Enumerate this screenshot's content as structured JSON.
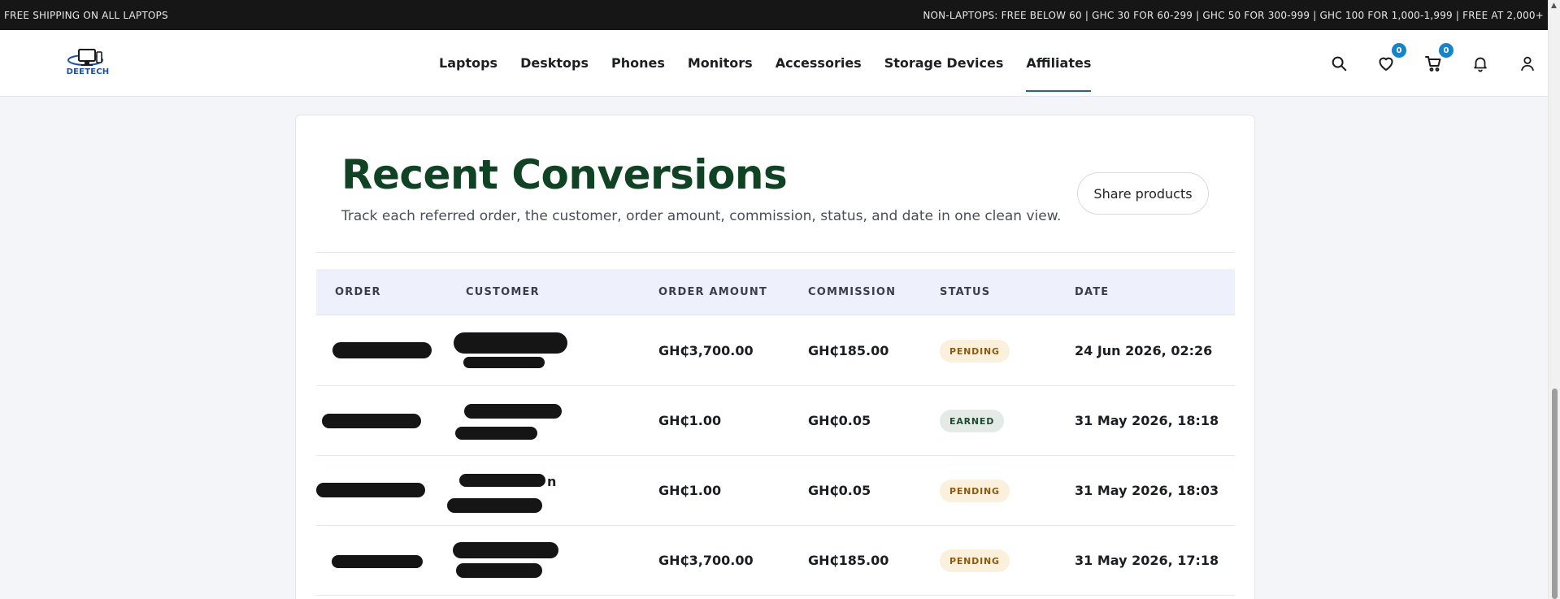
{
  "announcement": {
    "left": "FREE SHIPPING ON ALL LAPTOPS",
    "right": "NON-LAPTOPS: FREE BELOW 60 | GHC 30 FOR 60-299 | GHC 50 FOR 300-999 | GHC 100 FOR 1,000-1,999 | FREE AT 2,000+"
  },
  "brand": {
    "name": "DEETECH",
    "color": "#1d4fa3"
  },
  "nav": {
    "items": [
      {
        "label": "Laptops"
      },
      {
        "label": "Desktops"
      },
      {
        "label": "Phones"
      },
      {
        "label": "Monitors"
      },
      {
        "label": "Accessories"
      },
      {
        "label": "Storage Devices"
      },
      {
        "label": "Affiliates",
        "active": true
      }
    ]
  },
  "header_icons": {
    "wishlist_count": "0",
    "cart_count": "0",
    "icons": [
      "search-icon",
      "heart-icon",
      "cart-icon",
      "bell-icon",
      "user-icon"
    ]
  },
  "section": {
    "title": "Recent Conversions",
    "subtitle": "Track each referred order, the customer, order amount, commission, status, and date in one clean view.",
    "share_label": "Share products"
  },
  "table": {
    "headers": {
      "order": "ORDER",
      "customer": "CUSTOMER",
      "amount": "ORDER AMOUNT",
      "commission": "COMMISSION",
      "status": "STATUS",
      "date": "DATE"
    },
    "rows": [
      {
        "amount": "GH₵3,700.00",
        "commission": "GH₵185.00",
        "status": "PENDING",
        "date": "24 Jun 2026, 02:26"
      },
      {
        "amount": "GH₵1.00",
        "commission": "GH₵0.05",
        "status": "EARNED",
        "date": "31 May 2026, 18:18"
      },
      {
        "amount": "GH₵1.00",
        "commission": "GH₵0.05",
        "status": "PENDING",
        "date": "31 May 2026, 18:03"
      },
      {
        "amount": "GH₵3,700.00",
        "commission": "GH₵185.00",
        "status": "PENDING",
        "date": "31 May 2026, 17:18"
      }
    ]
  },
  "colors": {
    "title": "#0f4324",
    "accent": "#1565c0",
    "badge": "#1584c8",
    "pending_bg": "#fbf0dc",
    "pending_text": "#8c5a0e",
    "earned_bg": "#e4ebe6",
    "earned_text": "#1f4b2e"
  }
}
